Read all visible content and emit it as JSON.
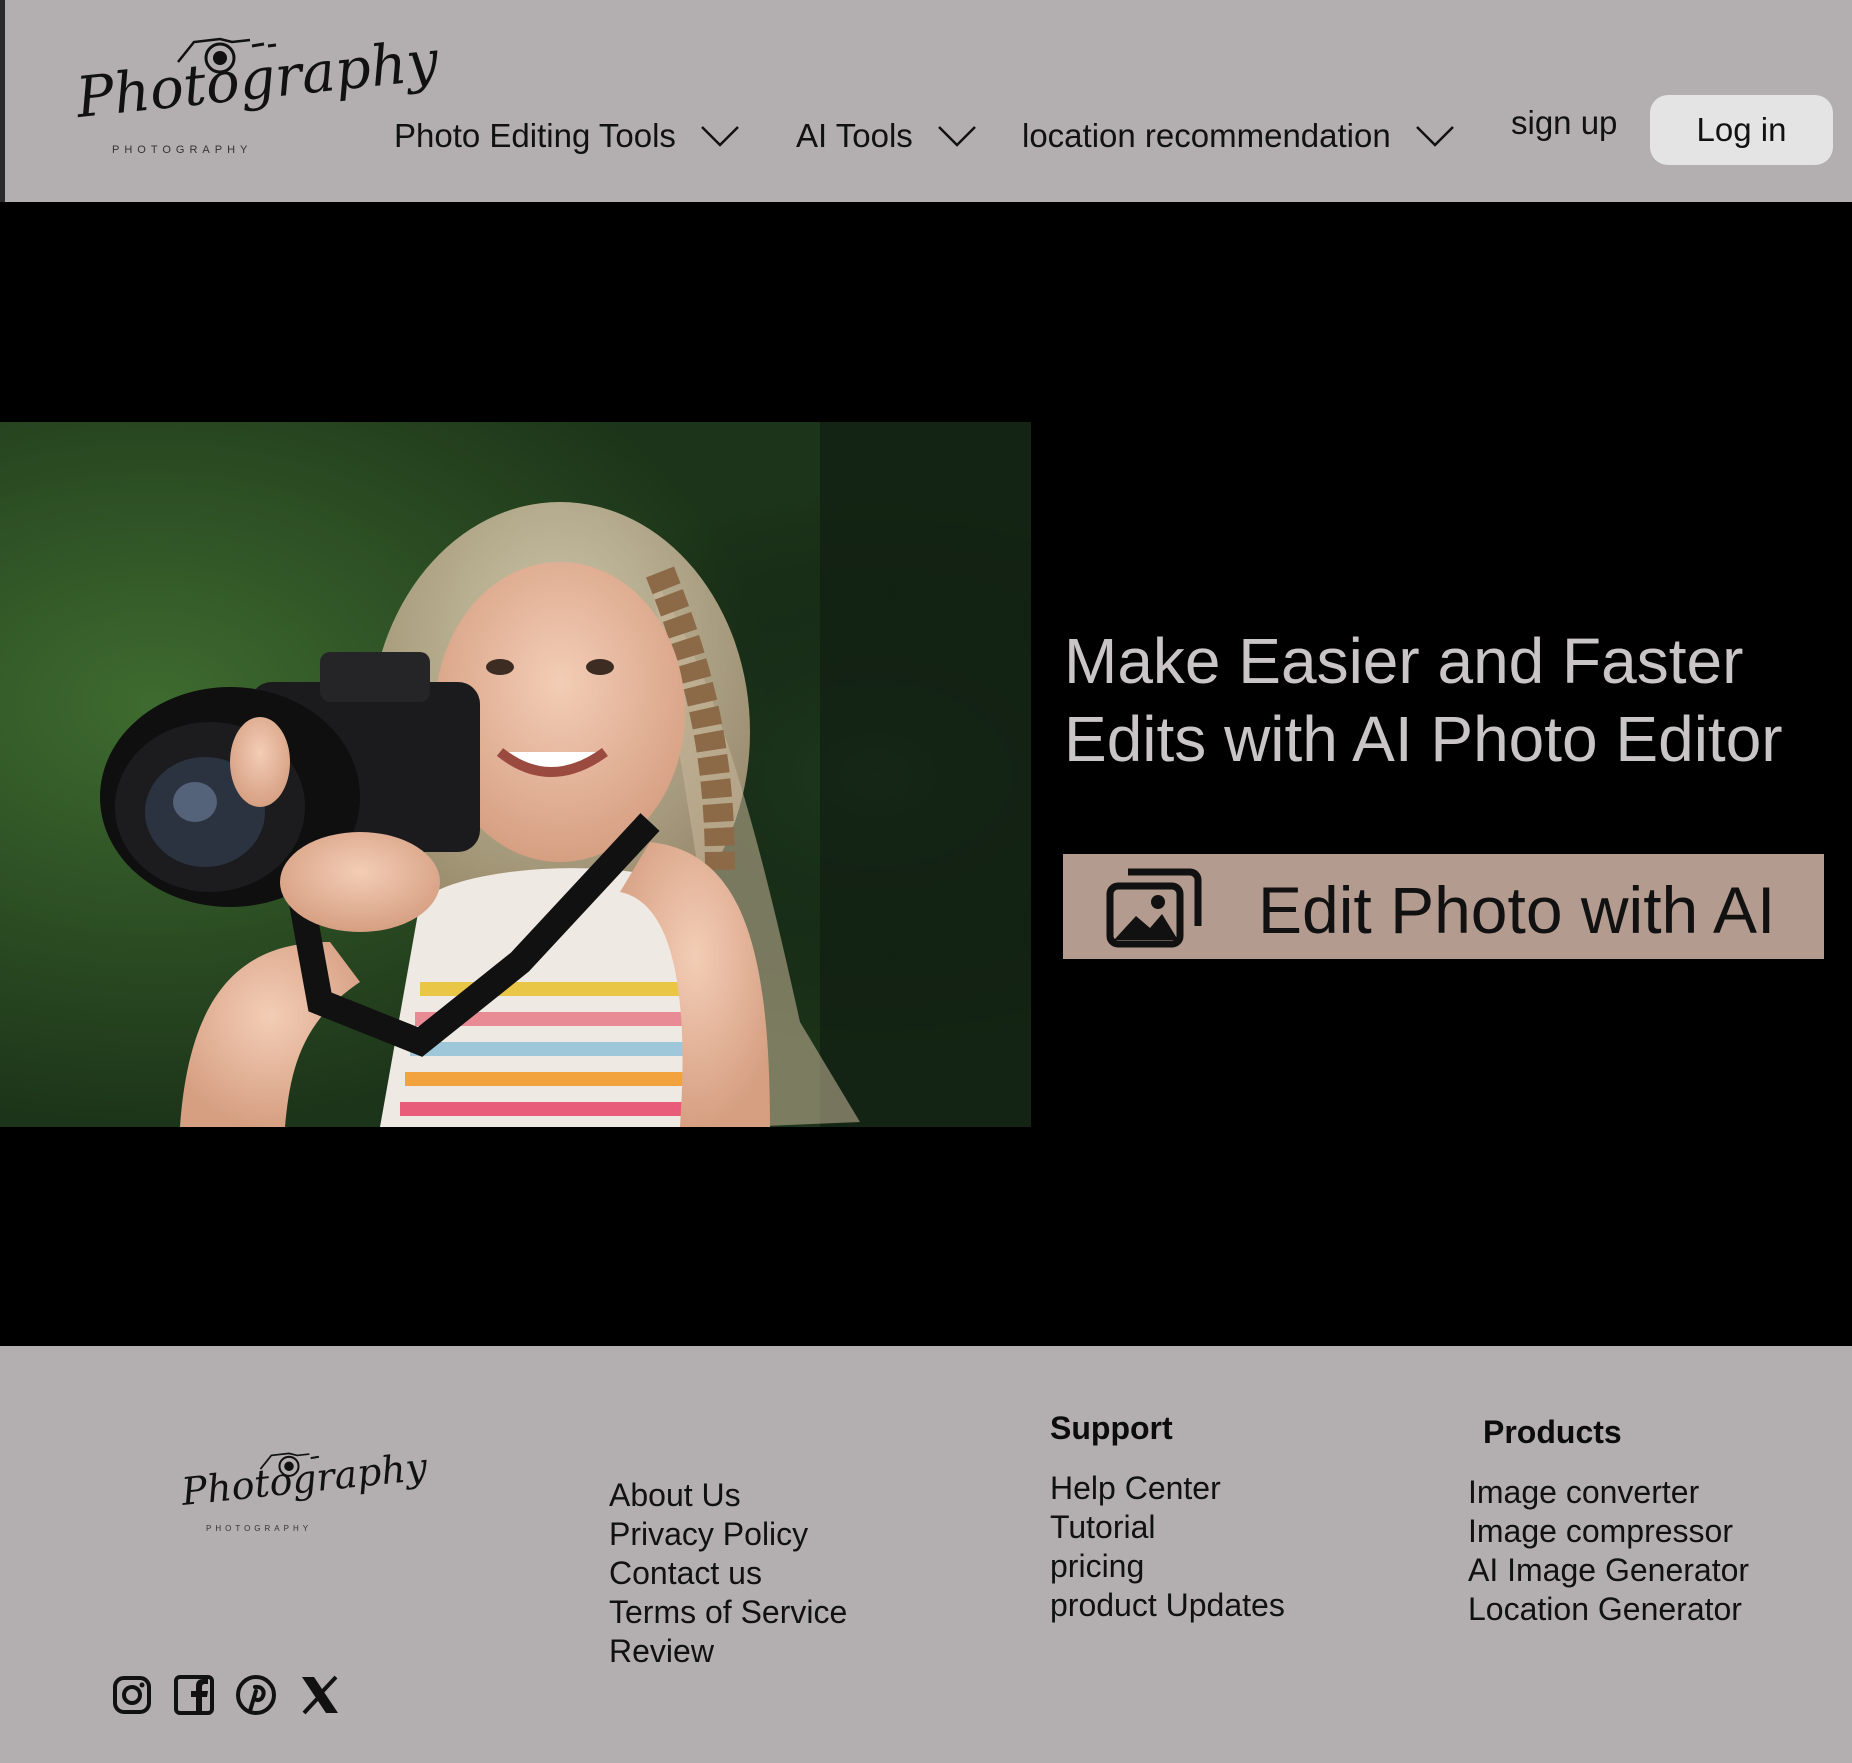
{
  "header": {
    "logo": {
      "script": "Photography",
      "subtitle": "PHOTOGRAPHY"
    },
    "nav": [
      {
        "label": "Photo Editing Tools"
      },
      {
        "label": "AI Tools"
      },
      {
        "label": "location recommendation"
      }
    ],
    "sign_up": "sign up",
    "log_in": "Log in"
  },
  "hero": {
    "headline_line1": "Make Easier and Faster",
    "headline_line2": "Edits with AI Photo Editor",
    "cta_label": "Edit Photo with AI",
    "cta_icon": "gallery-icon"
  },
  "footer": {
    "logo": {
      "script": "Photography",
      "subtitle": "PHOTOGRAPHY"
    },
    "company_links": [
      "About Us",
      "Privacy Policy",
      "Contact us",
      "Terms of Service",
      "Review"
    ],
    "support": {
      "heading": "Support",
      "links": [
        "Help Center",
        "Tutorial",
        "pricing",
        "product Updates"
      ]
    },
    "products": {
      "heading": "Products",
      "links": [
        "Image converter",
        "Image compressor",
        "AI Image Generator",
        "Location Generator"
      ]
    },
    "social": [
      "instagram-icon",
      "facebook-icon",
      "pinterest-icon",
      "x-icon"
    ]
  },
  "colors": {
    "header_bg": "#b3aeaf",
    "hero_bg": "#000000",
    "cta_bg": "#b49b90",
    "login_bg": "#e4e4e5",
    "headline": "#c9c5c6"
  }
}
